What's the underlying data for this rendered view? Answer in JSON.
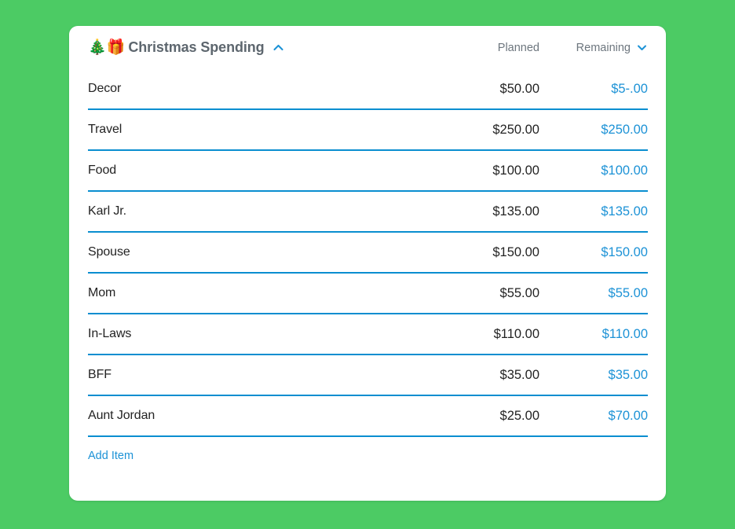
{
  "theme": {
    "background_color": "#4ccb64",
    "card_color": "#ffffff",
    "accent_blue": "#1c92d6",
    "divider_blue": "#0a8ed0",
    "title_color": "#5d666e",
    "label_color": "#232323",
    "header_gray": "#6d767e"
  },
  "card": {
    "title_emoji": "🎄🎁",
    "title": "Christmas Spending",
    "collapse_icon": "chevron-up-icon",
    "columns": {
      "planned": "Planned",
      "remaining": "Remaining",
      "remaining_sort_icon": "chevron-down-icon"
    },
    "rows": [
      {
        "label": "Decor",
        "planned": "$50.00",
        "remaining": "$5-.00"
      },
      {
        "label": "Travel",
        "planned": "$250.00",
        "remaining": "$250.00"
      },
      {
        "label": "Food",
        "planned": "$100.00",
        "remaining": "$100.00"
      },
      {
        "label": "Karl Jr.",
        "planned": "$135.00",
        "remaining": "$135.00"
      },
      {
        "label": "Spouse",
        "planned": "$150.00",
        "remaining": "$150.00"
      },
      {
        "label": "Mom",
        "planned": "$55.00",
        "remaining": "$55.00"
      },
      {
        "label": "In-Laws",
        "planned": "$110.00",
        "remaining": "$110.00"
      },
      {
        "label": "BFF",
        "planned": "$35.00",
        "remaining": "$35.00"
      },
      {
        "label": "Aunt Jordan",
        "planned": "$25.00",
        "remaining": "$70.00"
      }
    ],
    "add_item_label": "Add Item"
  }
}
